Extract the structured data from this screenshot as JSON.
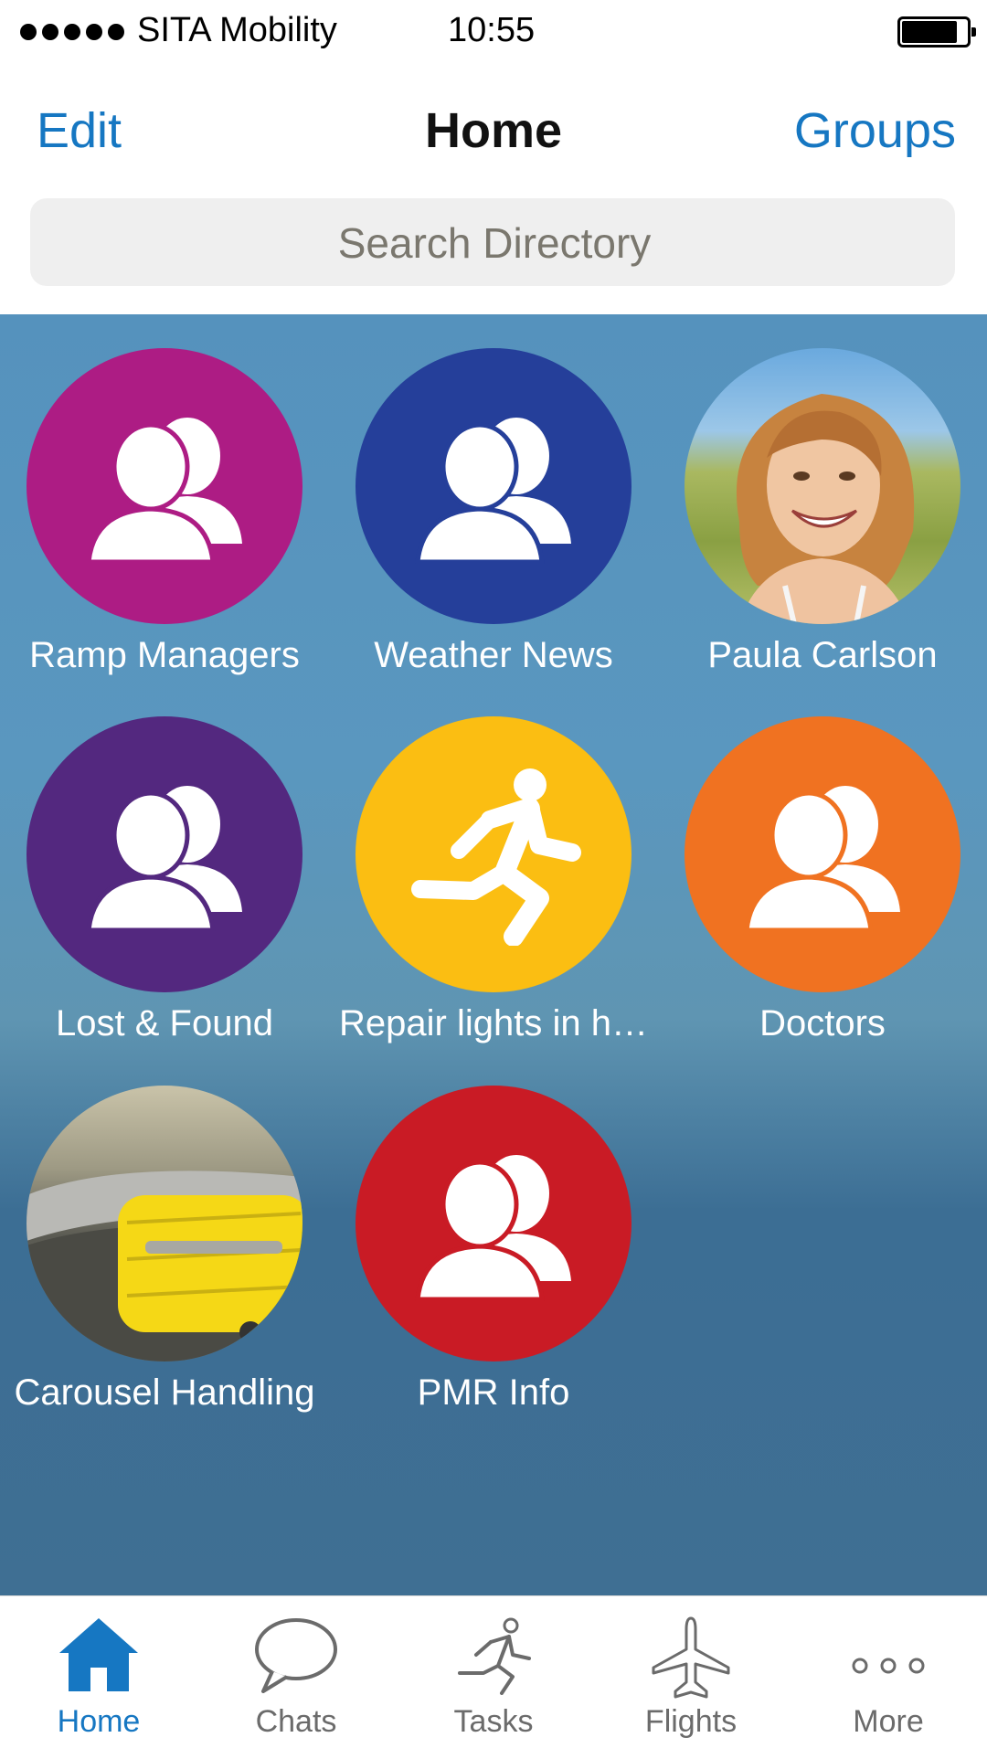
{
  "status_bar": {
    "carrier": "SITA Mobility",
    "time": "10:55"
  },
  "nav": {
    "edit": "Edit",
    "title": "Home",
    "groups": "Groups"
  },
  "search": {
    "placeholder": "Search Directory"
  },
  "tiles": [
    {
      "label": "Ramp Managers",
      "type": "group",
      "color": "#ad1c84"
    },
    {
      "label": "Weather News",
      "type": "group",
      "color": "#253f9a"
    },
    {
      "label": "Paula Carlson",
      "type": "person-photo",
      "color": "#7fb0d8"
    },
    {
      "label": "Lost & Found",
      "type": "group",
      "color": "#53287f"
    },
    {
      "label": "Repair lights in h…",
      "type": "task",
      "color": "#fbbe12"
    },
    {
      "label": "Doctors",
      "type": "group",
      "color": "#f07221"
    },
    {
      "label": "Carousel Handling",
      "type": "photo",
      "color": "#f2d413"
    },
    {
      "label": "PMR Info",
      "type": "group",
      "color": "#c91b25"
    }
  ],
  "tabs": [
    {
      "label": "Home",
      "icon": "home-icon",
      "active": true
    },
    {
      "label": "Chats",
      "icon": "chat-bubble-icon",
      "active": false
    },
    {
      "label": "Tasks",
      "icon": "running-person-icon",
      "active": false
    },
    {
      "label": "Flights",
      "icon": "airplane-icon",
      "active": false
    },
    {
      "label": "More",
      "icon": "more-dots-icon",
      "active": false
    }
  ],
  "colors": {
    "accent": "#1677c2",
    "inactive_tab": "#6b6b6b"
  }
}
